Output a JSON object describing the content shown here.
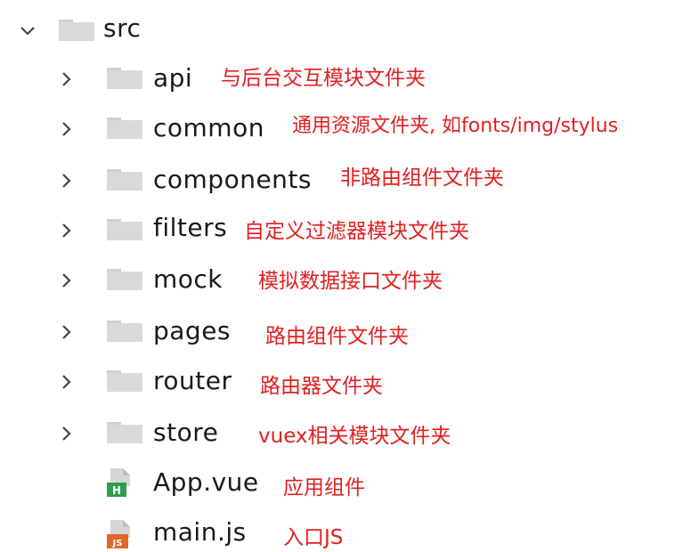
{
  "tree": {
    "root": {
      "name": "src",
      "expanded": true,
      "icon": "folder-icon"
    },
    "folders": [
      {
        "name": "api",
        "note": "与后台交互模块文件夹"
      },
      {
        "name": "common",
        "note": "通用资源文件夹, 如fonts/img/stylus"
      },
      {
        "name": "components",
        "note": "非路由组件文件夹"
      },
      {
        "name": "filters",
        "note": "自定义过滤器模块文件夹"
      },
      {
        "name": "mock",
        "note": "模拟数据接口文件夹"
      },
      {
        "name": "pages",
        "note": "路由组件文件夹"
      },
      {
        "name": "router",
        "note": "路由器文件夹"
      },
      {
        "name": "store",
        "note": "vuex相关模块文件夹"
      }
    ],
    "files": [
      {
        "name": "App.vue",
        "note": "应用组件",
        "badge": "H",
        "badge_color": "#2e9e4f"
      },
      {
        "name": "main.js",
        "note": "入口JS",
        "badge": "JS",
        "badge_color": "#e0662a"
      }
    ]
  },
  "colors": {
    "folder": "#d9d9d9",
    "annotation": "#e02020",
    "text": "#1a1a1a"
  }
}
